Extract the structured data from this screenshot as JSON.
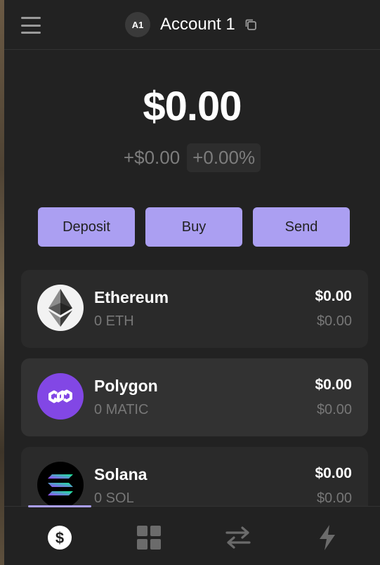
{
  "header": {
    "avatar_initials": "A1",
    "account_name": "Account 1"
  },
  "portfolio": {
    "balance": "$0.00",
    "change_abs": "+$0.00",
    "change_pct": "+0.00%"
  },
  "actions": {
    "deposit": "Deposit",
    "buy": "Buy",
    "send": "Send"
  },
  "tokens": [
    {
      "name": "Ethereum",
      "amount": "0 ETH",
      "value": "$0.00",
      "change": "$0.00",
      "icon": "ethereum-icon"
    },
    {
      "name": "Polygon",
      "amount": "0 MATIC",
      "value": "$0.00",
      "change": "$0.00",
      "icon": "polygon-icon"
    },
    {
      "name": "Solana",
      "amount": "0 SOL",
      "value": "$0.00",
      "change": "$0.00",
      "icon": "solana-icon"
    }
  ],
  "bottom_nav": {
    "items": [
      "dollar-icon",
      "grid-icon",
      "swap-icon",
      "lightning-icon"
    ],
    "active_index": 0
  },
  "colors": {
    "accent": "#ab9ff2",
    "background": "#222222",
    "card": "#2a2a2a",
    "polygon": "#8247e5"
  }
}
